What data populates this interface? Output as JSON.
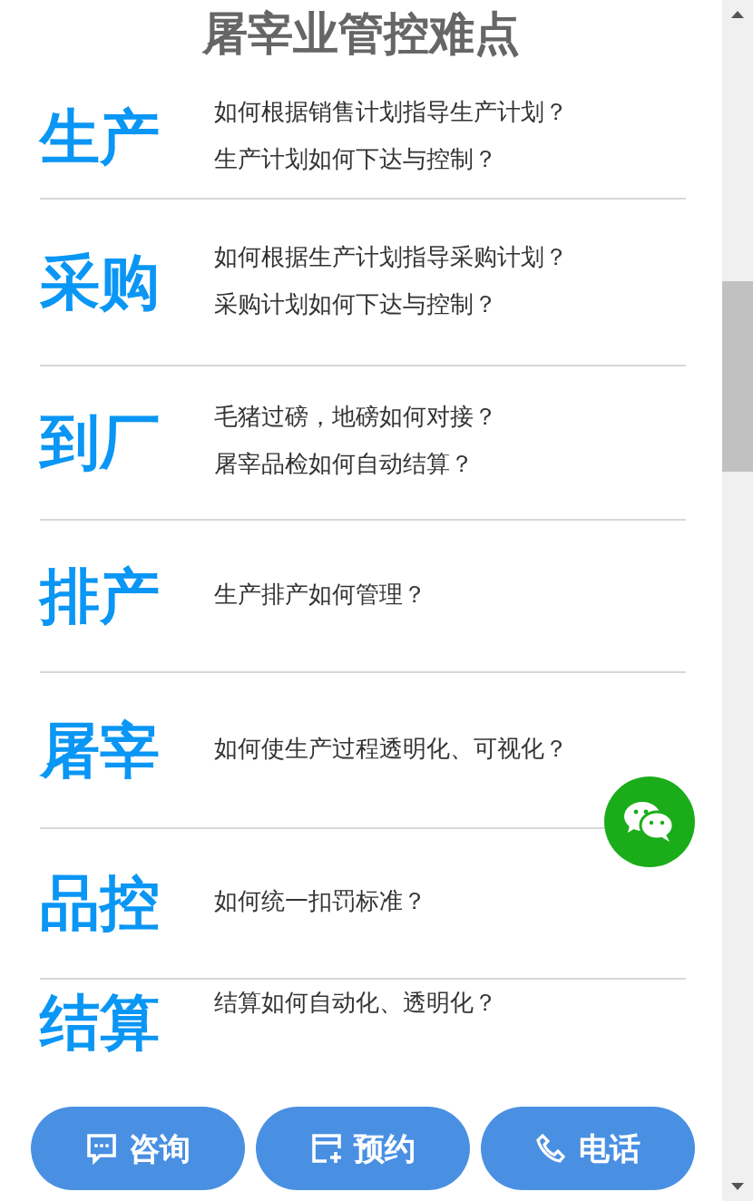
{
  "title": "屠宰业管控难点",
  "rows": [
    {
      "label": "生产",
      "lines": [
        "如何根据销售计划指导生产计划？",
        "生产计划如何下达与控制？"
      ]
    },
    {
      "label": "采购",
      "lines": [
        "如何根据生产计划指导采购计划？",
        "采购计划如何下达与控制？"
      ]
    },
    {
      "label": "到厂",
      "lines": [
        "毛猪过磅，地磅如何对接？",
        "屠宰品检如何自动结算？"
      ]
    },
    {
      "label": "排产",
      "lines": [
        "生产排产如何管理？"
      ]
    },
    {
      "label": "屠宰",
      "lines": [
        "如何使生产过程透明化、可视化？"
      ]
    },
    {
      "label": "品控",
      "lines": [
        "如何统一扣罚标准？"
      ]
    },
    {
      "label": "结算",
      "lines": [
        "结算如何自动化、透明化？"
      ]
    }
  ],
  "buttons": [
    {
      "kind": "chat",
      "label": "咨询"
    },
    {
      "kind": "booking",
      "label": "预约"
    },
    {
      "kind": "phone",
      "label": "电话"
    }
  ]
}
